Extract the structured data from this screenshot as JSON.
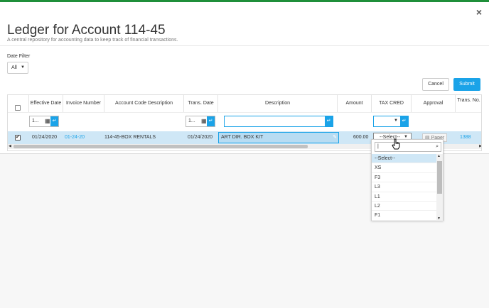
{
  "modal": {
    "close_glyph": "×",
    "title": "Ledger for Account 114-45",
    "subtitle": "A central repository for accounting data to keep track of financial transactions."
  },
  "filter": {
    "label": "Date Filter",
    "value": "All"
  },
  "buttons": {
    "cancel": "Cancel",
    "submit": "Submit"
  },
  "columns": {
    "effective_date": "Effective Date",
    "invoice_number": "Invoice Number",
    "account_code_description": "Account Code Description",
    "trans_date": "Trans. Date",
    "description": "Description",
    "amount": "Amount",
    "tax_cred": "TAX CRED",
    "approval": "Approval",
    "trans_no": "Trans. No."
  },
  "filters_row": {
    "effective_date": "1...",
    "trans_date": "1..."
  },
  "row": {
    "effective_date": "01/24/2020",
    "invoice_number": "01-24-20",
    "account_code_description": "114-45-BOX RENTALS",
    "trans_date": "01/24/2020",
    "description": "ART DIR. BOX KIT",
    "amount": "600.00",
    "tax_cred": "--Select--",
    "approval": "Paper",
    "trans_no": "1388"
  },
  "dropdown": {
    "search_value": "|",
    "options": [
      "--Select--",
      "XS",
      "F3",
      "L3",
      "L1",
      "L2",
      "F1"
    ]
  },
  "colors": {
    "accent": "#1aa3e8",
    "selected_row": "#cfe7f6",
    "topbar": "#1f8f3a"
  }
}
